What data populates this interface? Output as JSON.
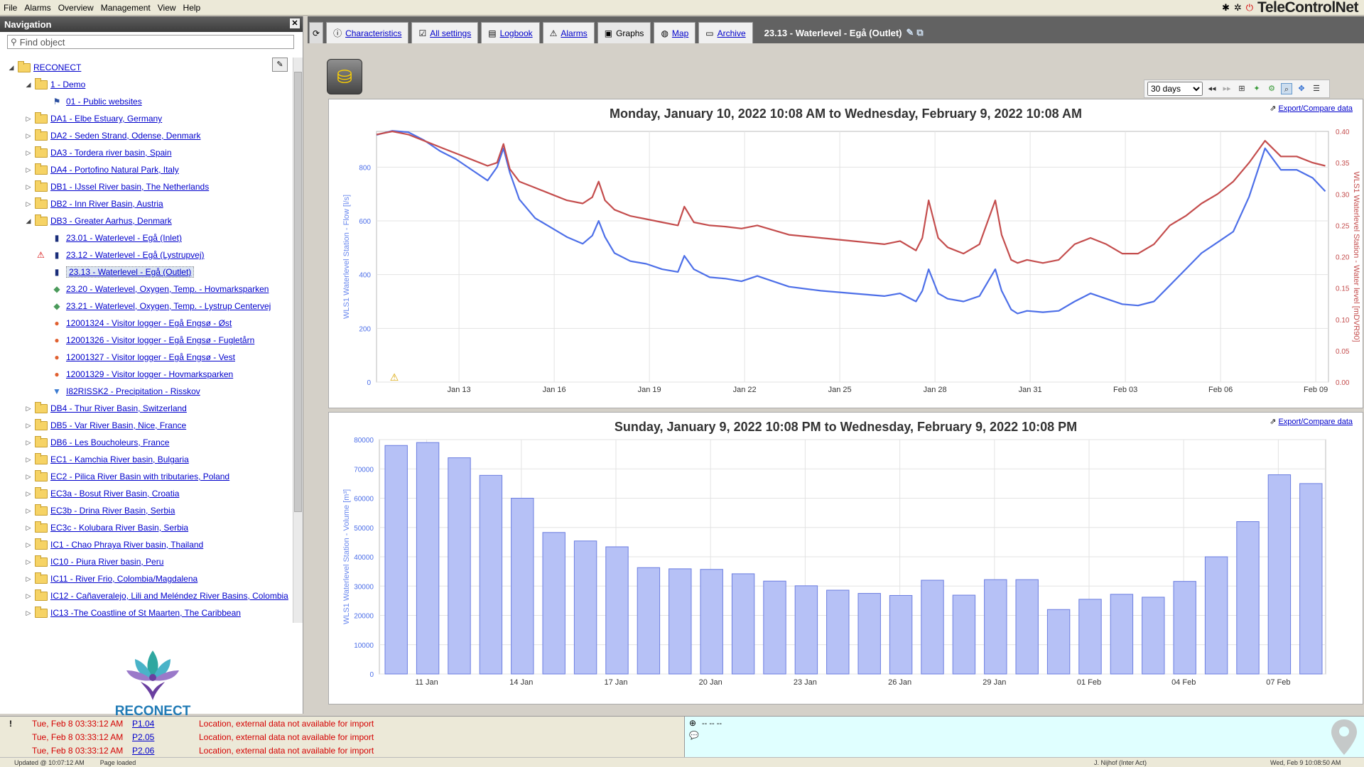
{
  "menu": {
    "items": [
      "File",
      "Alarms",
      "Overview",
      "Management",
      "View",
      "Help"
    ]
  },
  "brand": {
    "text": "TeleControlNet"
  },
  "nav": {
    "title": "Navigation",
    "search_placeholder": "Find object"
  },
  "tree": [
    {
      "label": "RECONECT",
      "depth": 0,
      "kind": "folder",
      "tw": "◢"
    },
    {
      "label": "1 - Demo",
      "depth": 1,
      "kind": "folder",
      "tw": "◢"
    },
    {
      "label": "01 - Public websites",
      "depth": 2,
      "kind": "site",
      "tw": ""
    },
    {
      "label": "DA1 - Elbe Estuary, Germany",
      "depth": 1,
      "kind": "folder",
      "tw": "▷"
    },
    {
      "label": "DA2 - Seden Strand, Odense, Denmark",
      "depth": 1,
      "kind": "folder",
      "tw": "▷"
    },
    {
      "label": "DA3 - Tordera river basin, Spain",
      "depth": 1,
      "kind": "folder",
      "tw": "▷"
    },
    {
      "label": "DA4 - Portofino Natural Park, Italy",
      "depth": 1,
      "kind": "folder",
      "tw": "▷"
    },
    {
      "label": "DB1 - IJssel River basin, The Netherlands",
      "depth": 1,
      "kind": "folder",
      "tw": "▷"
    },
    {
      "label": "DB2 - Inn River Basin, Austria",
      "depth": 1,
      "kind": "folder",
      "tw": "▷"
    },
    {
      "label": "DB3 - Greater Aarhus, Denmark",
      "depth": 1,
      "kind": "folder",
      "tw": "◢"
    },
    {
      "label": "23.01 - Waterlevel - Egå (Inlet)",
      "depth": 2,
      "kind": "station",
      "tw": ""
    },
    {
      "label": "23.12 - Waterlevel - Egå (Lystrupvej)",
      "depth": 2,
      "kind": "station",
      "tw": "",
      "warn": true
    },
    {
      "label": "23.13 - Waterlevel - Egå (Outlet)",
      "depth": 2,
      "kind": "station",
      "tw": "",
      "selected": true
    },
    {
      "label": "23.20 - Waterlevel, Oxygen, Temp. - Hovmarksparken",
      "depth": 2,
      "kind": "multi",
      "tw": ""
    },
    {
      "label": "23.21 - Waterlevel, Oxygen, Temp. - Lystrup Centervej",
      "depth": 2,
      "kind": "multi",
      "tw": ""
    },
    {
      "label": "12001324 - Visitor logger - Egå Engsø - Øst",
      "depth": 2,
      "kind": "visitor",
      "tw": ""
    },
    {
      "label": "12001326 - Visitor logger - Egå Engsø - Fugletårn",
      "depth": 2,
      "kind": "visitor",
      "tw": ""
    },
    {
      "label": "12001327 - Visitor logger - Egå Engsø - Vest",
      "depth": 2,
      "kind": "visitor",
      "tw": ""
    },
    {
      "label": "12001329 - Visitor logger - Hovmarksparken",
      "depth": 2,
      "kind": "visitor",
      "tw": ""
    },
    {
      "label": "I82RISSK2 - Precipitation - Risskov",
      "depth": 2,
      "kind": "precip",
      "tw": ""
    },
    {
      "label": "DB4 - Thur River Basin, Switzerland",
      "depth": 1,
      "kind": "folder",
      "tw": "▷"
    },
    {
      "label": "DB5 - Var River Basin, Nice, France",
      "depth": 1,
      "kind": "folder",
      "tw": "▷"
    },
    {
      "label": "DB6 - Les Boucholeurs, France",
      "depth": 1,
      "kind": "folder",
      "tw": "▷"
    },
    {
      "label": "EC1 - Kamchia River basin, Bulgaria",
      "depth": 1,
      "kind": "folder",
      "tw": "▷"
    },
    {
      "label": "EC2 - Pilica River Basin with tributaries, Poland",
      "depth": 1,
      "kind": "folder",
      "tw": "▷"
    },
    {
      "label": "EC3a - Bosut River Basin, Croatia",
      "depth": 1,
      "kind": "folder",
      "tw": "▷"
    },
    {
      "label": "EC3b - Drina River Basin, Serbia",
      "depth": 1,
      "kind": "folder",
      "tw": "▷"
    },
    {
      "label": "EC3c - Kolubara River Basin, Serbia",
      "depth": 1,
      "kind": "folder",
      "tw": "▷"
    },
    {
      "label": "IC1 - Chao Phraya River basin, Thailand",
      "depth": 1,
      "kind": "folder",
      "tw": "▷"
    },
    {
      "label": "IC10 - Piura River basin, Peru",
      "depth": 1,
      "kind": "folder",
      "tw": "▷"
    },
    {
      "label": "IC11 - River Frio, Colombia/Magdalena",
      "depth": 1,
      "kind": "folder",
      "tw": "▷"
    },
    {
      "label": "IC12 - Cañaveralejo, Lili and Meléndez River Basins, Colombia",
      "depth": 1,
      "kind": "folder",
      "tw": "▷"
    },
    {
      "label": "IC13 -The Coastline of St Maarten, The Caribbean",
      "depth": 1,
      "kind": "folder",
      "tw": "▷"
    }
  ],
  "nav_logo": {
    "text": "RECONECT"
  },
  "tabs": [
    {
      "label": "Characteristics",
      "icon": "info-icon",
      "link": true
    },
    {
      "label": "All settings",
      "icon": "settings-icon",
      "link": true
    },
    {
      "label": "Logbook",
      "icon": "logbook-icon",
      "link": true
    },
    {
      "label": "Alarms",
      "icon": "alarm-icon",
      "link": true
    },
    {
      "label": "Graphs",
      "icon": "graph-icon",
      "link": false,
      "active": true
    },
    {
      "label": "Map",
      "icon": "globe-icon",
      "link": true
    },
    {
      "label": "Archive",
      "icon": "archive-icon",
      "link": true
    }
  ],
  "page_title": "23.13 - Waterlevel - Egå (Outlet)",
  "toolbar": {
    "range": "30 days",
    "range_options": [
      "30 days"
    ]
  },
  "export_label": "Export/Compare data",
  "chart_data": [
    {
      "type": "line",
      "title": "Monday, January 10, 2022 10:08 AM to Wednesday, February 9, 2022 10:08 AM",
      "x_tick_labels": [
        "Jan 13",
        "Jan 16",
        "Jan 19",
        "Jan 22",
        "Jan 25",
        "Jan 28",
        "Jan 31",
        "Feb 03",
        "Feb 06",
        "Feb 09"
      ],
      "ylabel": "WLS1 Waterlevel Station - Flow [l/s]",
      "y2label": "WLS1 Waterlevel Station - Water level [mDVR90]",
      "ylim": [
        0,
        933
      ],
      "y_ticks": [
        0,
        200,
        400,
        600,
        800
      ],
      "y2lim": [
        0,
        0.4
      ],
      "y2_ticks": [
        "0.00",
        "0.05",
        "0.10",
        "0.15",
        "0.20",
        "0.25",
        "0.30",
        "0.35",
        "0.40"
      ],
      "grid": true,
      "series": [
        {
          "axis": "left",
          "color": "#4d6fe8",
          "x": [
            0,
            0.5,
            1,
            1.5,
            2,
            2.5,
            3,
            3.5,
            3.8,
            4.0,
            4.2,
            4.5,
            5,
            5.5,
            6,
            6.5,
            6.8,
            7.0,
            7.2,
            7.5,
            8,
            8.5,
            9,
            9.5,
            9.7,
            10,
            10.5,
            11,
            11.5,
            12,
            13,
            14,
            15,
            16,
            16.5,
            17,
            17.2,
            17.4,
            17.7,
            18,
            18.5,
            19,
            19.5,
            19.7,
            20,
            20.2,
            20.5,
            21,
            21.5,
            22,
            22.5,
            23,
            23.5,
            24,
            24.5,
            25,
            25.5,
            26,
            26.5,
            27,
            27.5,
            28,
            28.5,
            29,
            29.5,
            29.9
          ],
          "y": [
            920,
            935,
            930,
            900,
            860,
            830,
            790,
            750,
            800,
            870,
            780,
            680,
            610,
            575,
            540,
            515,
            545,
            600,
            540,
            480,
            450,
            440,
            420,
            410,
            470,
            420,
            390,
            385,
            375,
            395,
            355,
            340,
            330,
            320,
            330,
            300,
            340,
            420,
            330,
            310,
            300,
            320,
            420,
            340,
            270,
            255,
            265,
            260,
            265,
            300,
            330,
            310,
            290,
            285,
            300,
            360,
            420,
            480,
            520,
            560,
            690,
            870,
            790,
            790,
            760,
            710
          ]
        },
        {
          "axis": "right",
          "color": "#c44d4d",
          "x": [
            0,
            0.5,
            1,
            1.5,
            2,
            2.5,
            3,
            3.5,
            3.8,
            4.0,
            4.2,
            4.5,
            5,
            5.5,
            6,
            6.5,
            6.8,
            7.0,
            7.2,
            7.5,
            8,
            8.5,
            9,
            9.5,
            9.7,
            10,
            10.5,
            11,
            11.5,
            12,
            13,
            14,
            15,
            16,
            16.5,
            17,
            17.2,
            17.4,
            17.7,
            18,
            18.5,
            19,
            19.5,
            19.7,
            20,
            20.2,
            20.5,
            21,
            21.5,
            22,
            22.5,
            23,
            23.5,
            24,
            24.5,
            25,
            25.5,
            26,
            26.5,
            27,
            27.5,
            28,
            28.5,
            29,
            29.5,
            29.9
          ],
          "y": [
            0.395,
            0.4,
            0.395,
            0.385,
            0.375,
            0.365,
            0.355,
            0.345,
            0.35,
            0.38,
            0.34,
            0.32,
            0.31,
            0.3,
            0.29,
            0.285,
            0.295,
            0.32,
            0.29,
            0.275,
            0.265,
            0.26,
            0.255,
            0.25,
            0.28,
            0.255,
            0.25,
            0.248,
            0.245,
            0.25,
            0.235,
            0.23,
            0.225,
            0.22,
            0.225,
            0.21,
            0.23,
            0.29,
            0.23,
            0.215,
            0.205,
            0.22,
            0.29,
            0.235,
            0.195,
            0.19,
            0.195,
            0.19,
            0.195,
            0.22,
            0.23,
            0.22,
            0.205,
            0.205,
            0.22,
            0.25,
            0.265,
            0.285,
            0.3,
            0.32,
            0.35,
            0.385,
            0.36,
            0.36,
            0.35,
            0.345
          ]
        }
      ]
    },
    {
      "type": "bar",
      "title": "Sunday, January 9, 2022 10:08 PM to Wednesday, February 9, 2022 10:08 PM",
      "x_tick_labels": [
        "11 Jan",
        "14 Jan",
        "17 Jan",
        "20 Jan",
        "23 Jan",
        "26 Jan",
        "29 Jan",
        "01 Feb",
        "04 Feb",
        "07 Feb"
      ],
      "ylabel": "WLS1 Waterlevel Station - Volume [m³]",
      "ylim": [
        0,
        80000
      ],
      "y_ticks": [
        0,
        10000,
        20000,
        30000,
        40000,
        50000,
        60000,
        70000,
        80000
      ],
      "grid": true,
      "color": "#b6c1f6",
      "edge": "#6b7de0",
      "categories": [
        "10 Jan",
        "11 Jan",
        "12 Jan",
        "13 Jan",
        "14 Jan",
        "15 Jan",
        "16 Jan",
        "17 Jan",
        "18 Jan",
        "19 Jan",
        "20 Jan",
        "21 Jan",
        "22 Jan",
        "23 Jan",
        "24 Jan",
        "25 Jan",
        "26 Jan",
        "27 Jan",
        "28 Jan",
        "29 Jan",
        "30 Jan",
        "31 Jan",
        "01 Feb",
        "02 Feb",
        "03 Feb",
        "04 Feb",
        "05 Feb",
        "06 Feb",
        "07 Feb",
        "08 Feb"
      ],
      "values": [
        78000,
        79000,
        73800,
        67800,
        60000,
        48300,
        45400,
        43400,
        36300,
        35900,
        35700,
        34200,
        31700,
        30100,
        28600,
        27500,
        26800,
        32000,
        26900,
        32200,
        32200,
        22000,
        25500,
        27200,
        26200,
        31600,
        40000,
        52000,
        68000,
        65000
      ]
    }
  ],
  "alerts": [
    {
      "time": "Tue, Feb 8 03:33:12 AM",
      "code": "P1.04",
      "message": "Location, external data not available for import"
    },
    {
      "time": "Tue, Feb 8 03:33:12 AM",
      "code": "P2.05",
      "message": "Location, external data not available for import"
    },
    {
      "time": "Tue, Feb 8 03:33:12 AM",
      "code": "P2.06",
      "message": "Location, external data not available for import"
    }
  ],
  "info_box": {
    "line": "-- -- --"
  },
  "status": {
    "updated": "Updated @ 10:07:12 AM",
    "loaded": "Page loaded",
    "user": "J. Nijhof (Inter Act)",
    "datetime": "Wed, Feb 9 10:08:50 AM"
  }
}
